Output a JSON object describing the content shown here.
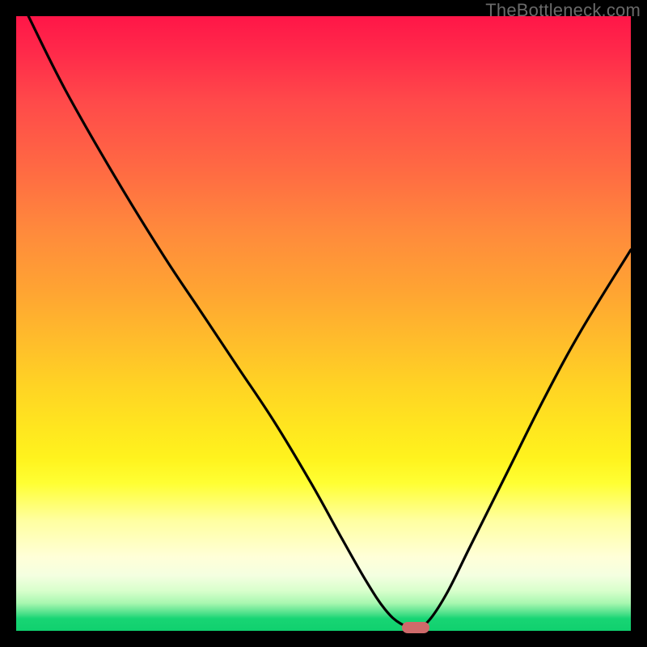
{
  "watermark": "TheBottleneck.com",
  "colors": {
    "frame": "#000000",
    "curve": "#000000",
    "marker": "#cf6a6a",
    "watermark": "#6a6a6a"
  },
  "chart_data": {
    "type": "line",
    "title": "",
    "xlabel": "",
    "ylabel": "",
    "xlim": [
      0,
      100
    ],
    "ylim": [
      0,
      100
    ],
    "grid": false,
    "legend": false,
    "series": [
      {
        "name": "bottleneck-curve",
        "x": [
          2,
          8,
          16,
          24,
          30,
          36,
          42,
          48,
          53,
          57,
          60,
          62.5,
          65,
          67,
          70,
          74,
          80,
          86,
          92,
          100
        ],
        "y": [
          100,
          88,
          74,
          61,
          52,
          43,
          34,
          24,
          15,
          8,
          3.5,
          1.2,
          0.5,
          1.5,
          6,
          14,
          26,
          38,
          49,
          62
        ]
      }
    ],
    "annotations": [
      {
        "name": "optimal-marker",
        "x": 65,
        "y": 0.5,
        "shape": "pill",
        "color": "#cf6a6a"
      }
    ]
  }
}
